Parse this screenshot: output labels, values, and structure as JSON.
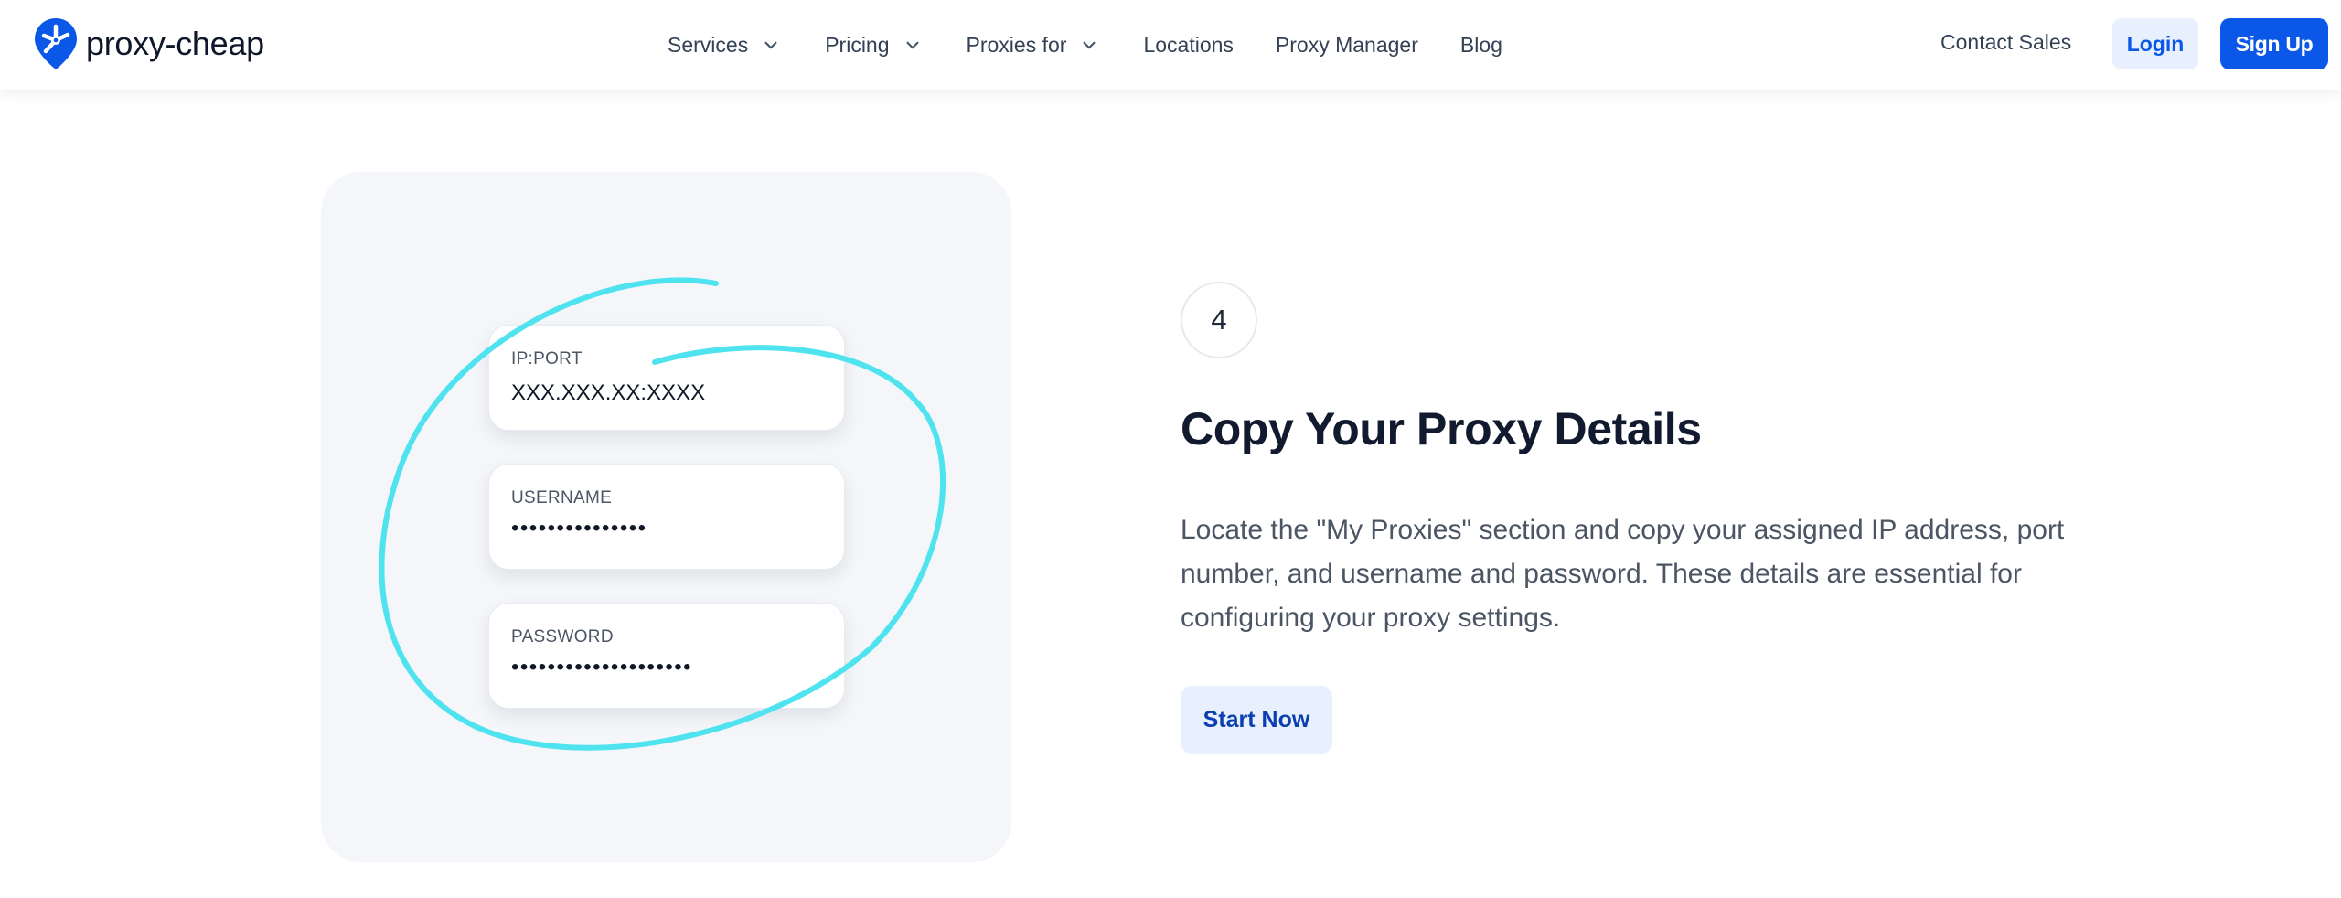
{
  "header": {
    "brand": "proxy-cheap",
    "nav": [
      {
        "label": "Services",
        "has_dropdown": true
      },
      {
        "label": "Pricing",
        "has_dropdown": true
      },
      {
        "label": "Proxies for",
        "has_dropdown": true
      },
      {
        "label": "Locations",
        "has_dropdown": false
      },
      {
        "label": "Proxy Manager",
        "has_dropdown": false
      },
      {
        "label": "Blog",
        "has_dropdown": false
      }
    ],
    "contact_label": "Contact Sales",
    "login_label": "Login",
    "signup_label": "Sign Up"
  },
  "illustration": {
    "fields": [
      {
        "label": "IP:PORT",
        "value": "XXX.XXX.XX:XXXX"
      },
      {
        "label": "USERNAME",
        "value": "•••••••••••••••"
      },
      {
        "label": "PASSWORD",
        "value": "••••••••••••••••••••"
      }
    ]
  },
  "step": {
    "number": "4",
    "title": "Copy Your Proxy Details",
    "description": "Locate the \"My Proxies\" section and copy your assigned IP address, port number, and username and password. These details are essential for configuring your proxy settings.",
    "cta_label": "Start Now"
  },
  "colors": {
    "brand_blue": "#0b57e8",
    "login_bg": "#e8f0fd",
    "scribble": "#4fe3ef",
    "card_bg": "#f4f6f9",
    "title": "#111a2e",
    "body_text": "#4b5563"
  },
  "icons": {
    "logo": "proxy-cheap-pin-logo",
    "dropdown": "chevron-down-icon"
  }
}
